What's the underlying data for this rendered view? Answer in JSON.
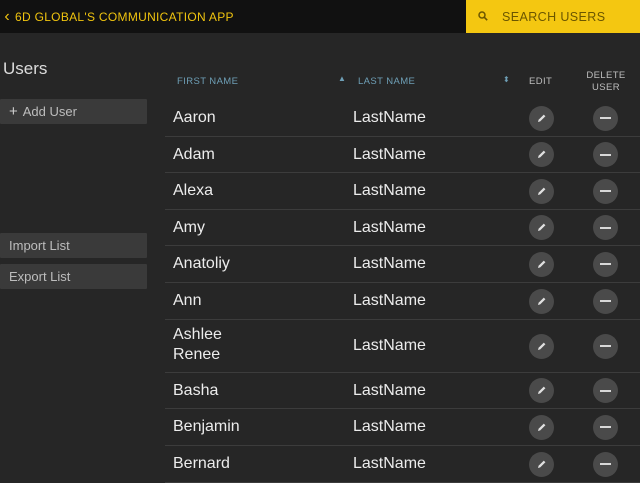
{
  "header": {
    "back_icon": "chevron-left-icon",
    "app_title": "6D GLOBAL'S COMMUNICATION APP",
    "search_label": "SEARCH USERS",
    "accent_color": "#f4c711"
  },
  "sidebar": {
    "title": "Users",
    "add_user": "Add User",
    "import_list": "Import List",
    "export_list": "Export List"
  },
  "table": {
    "col_first": "FIRST NAME",
    "col_last": "LAST NAME",
    "col_edit": "EDIT",
    "col_delete_1": "DELETE",
    "col_delete_2": "USER",
    "rows": [
      {
        "first": "Aaron",
        "last": "LastName"
      },
      {
        "first": "Adam",
        "last": "LastName"
      },
      {
        "first": "Alexa",
        "last": "LastName"
      },
      {
        "first": "Amy",
        "last": "LastName"
      },
      {
        "first": "Anatoliy",
        "last": "LastName"
      },
      {
        "first": "Ann",
        "last": "LastName"
      },
      {
        "first": "Ashlee Renee",
        "last": "LastName"
      },
      {
        "first": "Basha",
        "last": "LastName"
      },
      {
        "first": "Benjamin",
        "last": "LastName"
      },
      {
        "first": "Bernard",
        "last": "LastName"
      }
    ]
  }
}
